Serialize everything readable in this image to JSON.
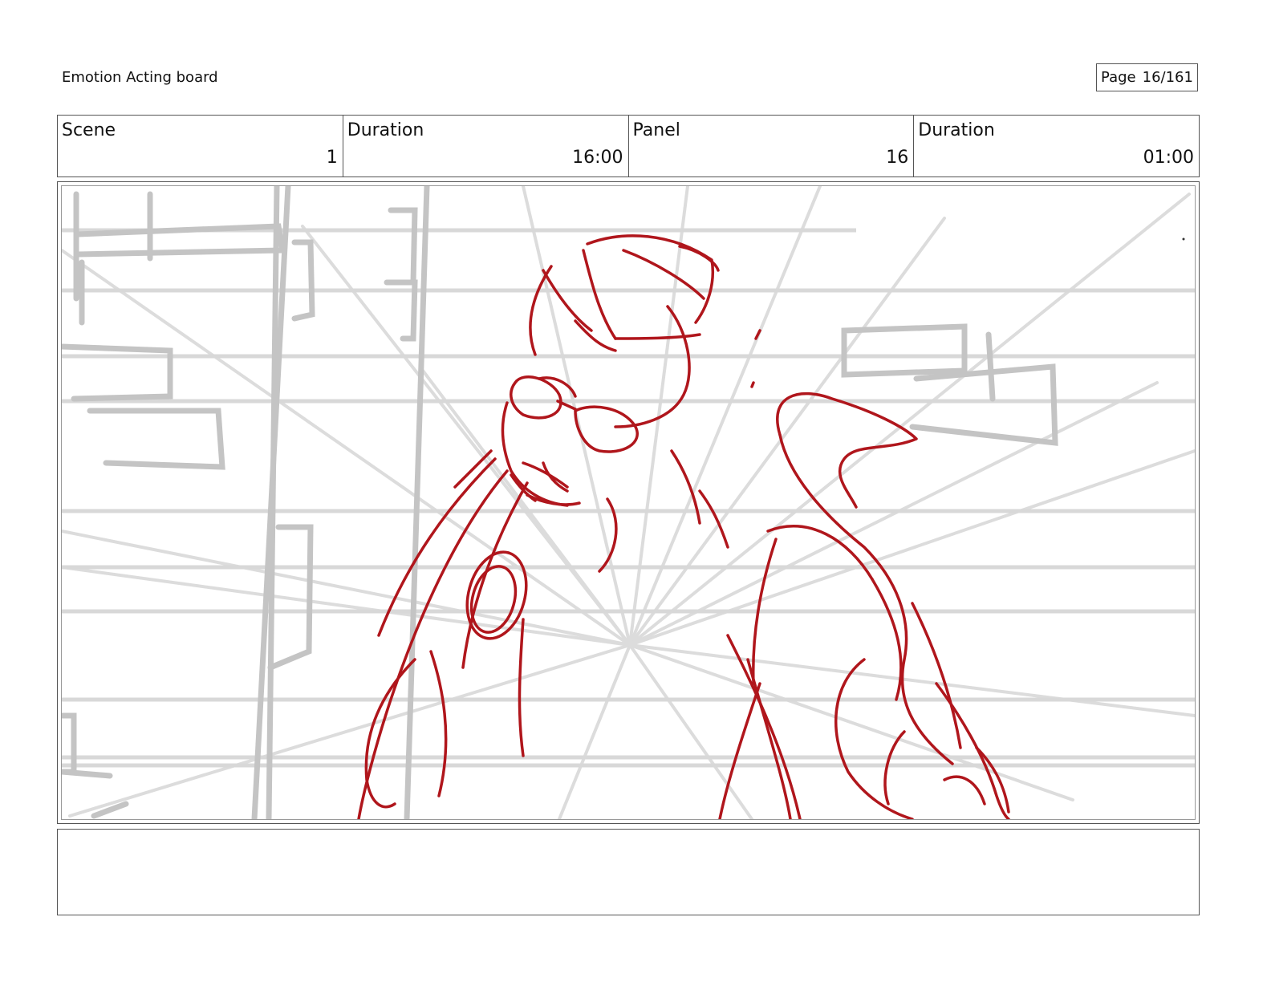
{
  "header": {
    "title": "Emotion Acting board",
    "page_label": "Page",
    "page_value": "16/161"
  },
  "info": {
    "scene_label": "Scene",
    "scene_value": "1",
    "scene_duration_label": "Duration",
    "scene_duration_value": "16:00",
    "panel_label": "Panel",
    "panel_value": "16",
    "panel_duration_label": "Duration",
    "panel_duration_value": "01:00"
  },
  "notes": {
    "text": ""
  },
  "colors": {
    "sketch_red": "#b0161c",
    "guide_gray": "#cfcfcf",
    "border": "#555555"
  }
}
